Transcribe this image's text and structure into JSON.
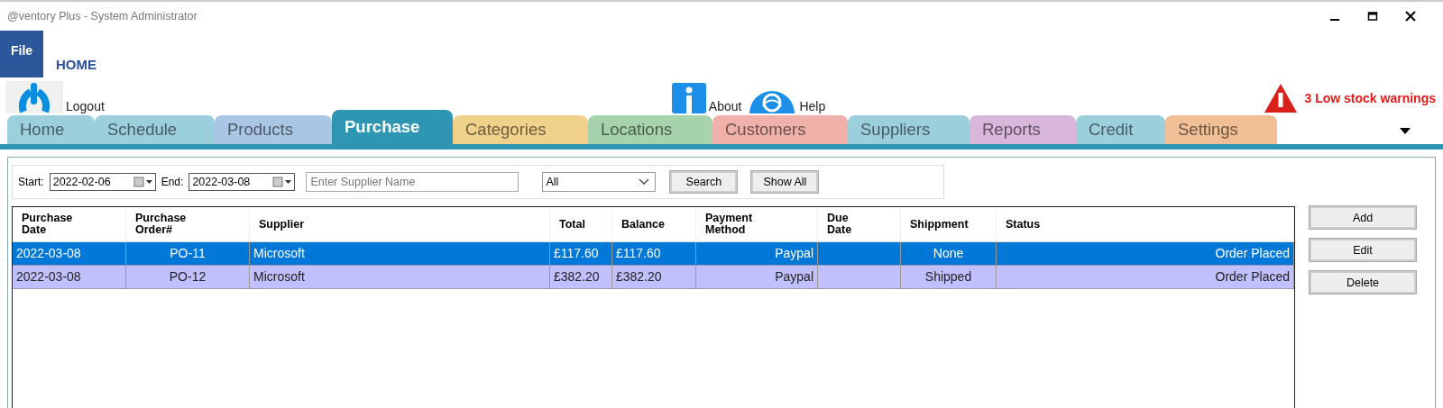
{
  "window": {
    "title": "@ventory Plus - System Administrator"
  },
  "file_button": "File",
  "ribbon_tab": "HOME",
  "ribbon": {
    "logout": "Logout",
    "about": "About",
    "help": "Help",
    "warning": "3 Low stock warnings"
  },
  "tabs": [
    {
      "label": "Home",
      "color": "#9ccfdc",
      "selected": false
    },
    {
      "label": "Schedule",
      "color": "#9ccfdc",
      "selected": false
    },
    {
      "label": "Products",
      "color": "#a9c6e4",
      "selected": false
    },
    {
      "label": "Purchase",
      "color": "#2e96b2",
      "selected": true
    },
    {
      "label": "Categories",
      "color": "#efd18c",
      "selected": false
    },
    {
      "label": "Locations",
      "color": "#a6d3ac",
      "selected": false
    },
    {
      "label": "Customers",
      "color": "#f0b1ab",
      "selected": false
    },
    {
      "label": "Suppliers",
      "color": "#9ccfdc",
      "selected": false
    },
    {
      "label": "Reports",
      "color": "#d8b7da",
      "selected": false
    },
    {
      "label": "Credit",
      "color": "#9ccfdc",
      "selected": false
    },
    {
      "label": "Settings",
      "color": "#f0bf95",
      "selected": false
    }
  ],
  "filter": {
    "start_label": "Start:",
    "start": "2022-02-06",
    "end_label": "End:",
    "end": "2022-03-08",
    "supplier_placeholder": "Enter Supplier Name",
    "status": "All",
    "search": "Search",
    "show_all": "Show All"
  },
  "table": {
    "columns": [
      "Purchase Date",
      "Purchase Order#",
      "Supplier",
      "Total",
      "Balance",
      "Payment Method",
      "Due Date",
      "Shippment",
      "Status"
    ],
    "rows": [
      {
        "selected": true,
        "cells": [
          "2022-03-08",
          "PO-11",
          "Microsoft",
          "£117.60",
          "£117.60",
          "Paypal",
          "",
          "None",
          "Order Placed"
        ]
      },
      {
        "selected": false,
        "cells": [
          "2022-03-08",
          "PO-12",
          "Microsoft",
          "£382.20",
          "£382.20",
          "Paypal",
          "",
          "Shipped",
          "Order Placed"
        ]
      }
    ]
  },
  "buttons": [
    "Add",
    "Edit",
    "Delete"
  ]
}
